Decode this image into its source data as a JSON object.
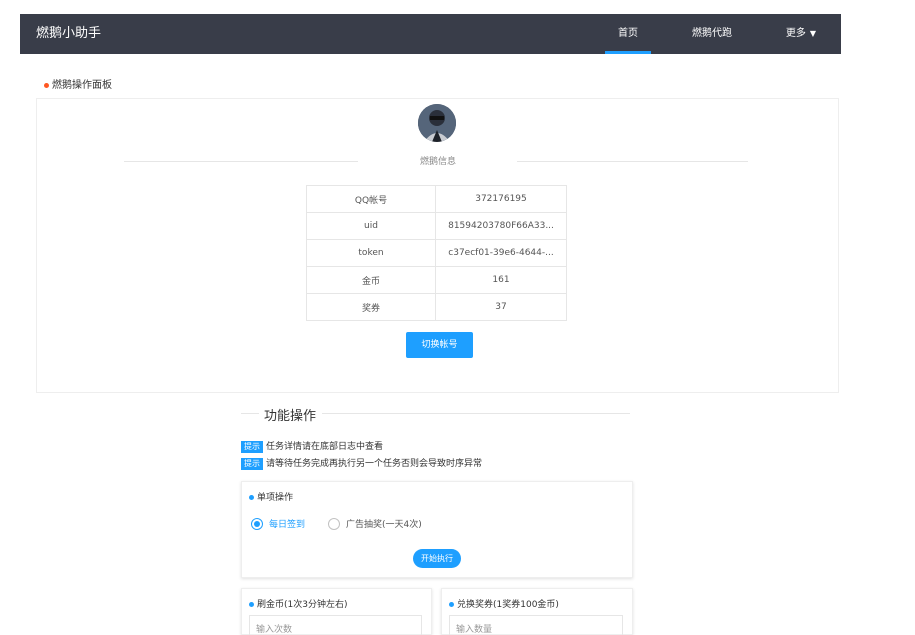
{
  "header": {
    "brand": "燃鹅小助手",
    "nav": [
      {
        "label": "首页",
        "active": true
      },
      {
        "label": "燃鹅代跑",
        "active": false
      },
      {
        "label": "更多",
        "active": false
      }
    ]
  },
  "panel": {
    "title": "燃鹅操作面板",
    "section_label": "燃鹅信息",
    "info": [
      {
        "label": "QQ帐号",
        "value": "372176195"
      },
      {
        "label": "uid",
        "value": "81594203780F66A33..."
      },
      {
        "label": "token",
        "value": "c37ecf01-39e6-4644-..."
      },
      {
        "label": "金币",
        "value": "161"
      },
      {
        "label": "奖券",
        "value": "37"
      }
    ],
    "switch_button": "切换帐号"
  },
  "functions": {
    "title": "功能操作",
    "tips": [
      {
        "badge": "提示",
        "text": "任务详情请在底部日志中查看"
      },
      {
        "badge": "提示",
        "text": "请等待任务完成再执行另一个任务否则会导致时序异常"
      }
    ],
    "single": {
      "title": "单项操作",
      "options": [
        {
          "label": "每日签到",
          "checked": true
        },
        {
          "label": "广告抽奖(一天4次)",
          "checked": false
        }
      ],
      "start_button": "开始执行"
    },
    "coins": {
      "title": "刷金币(1次3分钟左右)",
      "input_placeholder": "输入次数"
    },
    "exchange": {
      "title": "兑换奖券(1奖券100金币)",
      "input_placeholder": "输入数量"
    }
  },
  "colors": {
    "accent": "#1e9fff",
    "header_bg": "#393d49",
    "title_dot": "#ff5722"
  },
  "icons": {
    "caret": "caret-down-icon"
  }
}
